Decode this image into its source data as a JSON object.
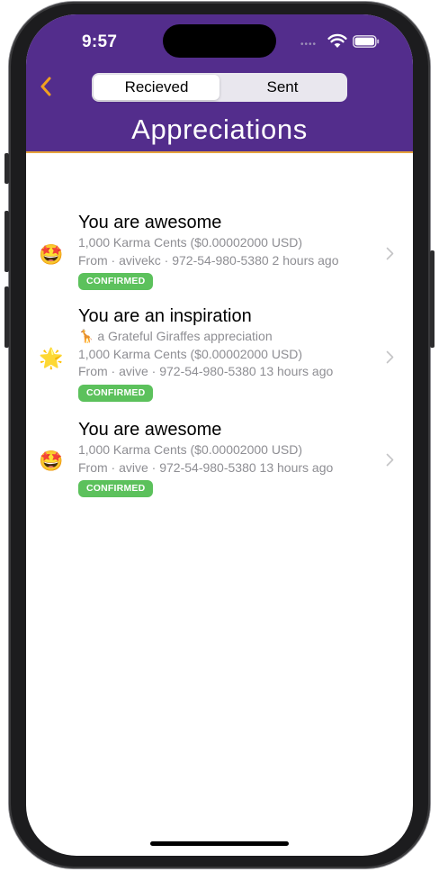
{
  "status_bar": {
    "time": "9:57",
    "signal_dots": "••••"
  },
  "nav": {
    "back_icon": "chevron-left-icon",
    "tabs": [
      {
        "label": "Recieved",
        "selected": true
      },
      {
        "label": "Sent",
        "selected": false
      }
    ],
    "title": "Appreciations"
  },
  "colors": {
    "header_bg": "#532d8c",
    "accent": "#f0a020",
    "badge_green": "#5cc15c",
    "secondary_text": "#8e8e93"
  },
  "appreciations": [
    {
      "emoji": "🤩",
      "title": "You are awesome",
      "lines": [
        "1,000 Karma Cents ($0.00002000 USD)",
        "From · avivekc · 972-54-980-5380 2 hours ago"
      ],
      "status": "CONFIRMED"
    },
    {
      "emoji": "🌟",
      "title": "You are an inspiration",
      "lines": [
        "🦒 a Grateful Giraffes appreciation",
        "1,000 Karma Cents ($0.00002000 USD)",
        "From · avive · 972-54-980-5380 13 hours ago"
      ],
      "status": "CONFIRMED"
    },
    {
      "emoji": "🤩",
      "title": "You are awesome",
      "lines": [
        "1,000 Karma Cents ($0.00002000 USD)",
        "From · avive · 972-54-980-5380 13 hours ago"
      ],
      "status": "CONFIRMED"
    }
  ]
}
